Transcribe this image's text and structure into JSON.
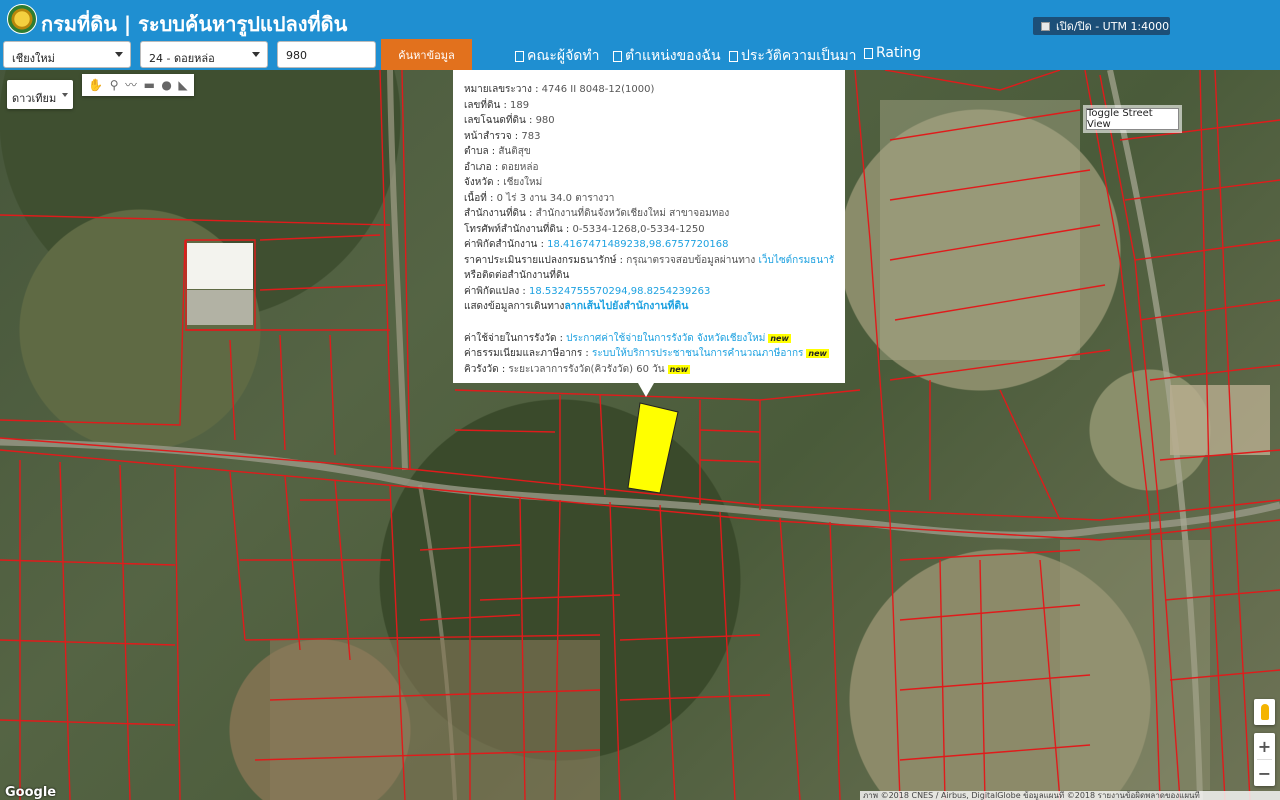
{
  "header": {
    "title": "กรมที่ดิน | ระบบค้นหารูปแปลงที่ดิน",
    "utm_toggle": "เปิด/ปิด - UTM 1:4000"
  },
  "search": {
    "province": "เชียงใหม่",
    "district": "24 - ดอยหล่อ",
    "parcel_number": "980",
    "button_label": "ค้นหาข้อมูล"
  },
  "nav": {
    "items": [
      {
        "label": "คณะผู้จัดทำ"
      },
      {
        "label": "ตำแหน่งของฉัน"
      },
      {
        "label": "ประวัติความเป็นมา"
      },
      {
        "label": "Rating"
      }
    ]
  },
  "map": {
    "type_selected": "ดาวเทียม",
    "streetview_label": "Toggle Street View",
    "google_logo": "Google",
    "attribution": "ภาพ ©2018 CNES / Airbus, DigitalGlobe  ข้อมูลแผนที่ ©2018  รายงานข้อผิดพลาดของแผนที่",
    "zoom_in": "+",
    "zoom_out": "−",
    "highlight_color": "#ffff00",
    "parcel_line_color": "#e01b1b"
  },
  "draw_tools": [
    {
      "icon": "hand-icon",
      "glyph": "✋"
    },
    {
      "icon": "marker-icon",
      "glyph": "⚲"
    },
    {
      "icon": "polyline-icon",
      "glyph": "〰"
    },
    {
      "icon": "rectangle-icon",
      "glyph": "▬"
    },
    {
      "icon": "circle-icon",
      "glyph": "●"
    },
    {
      "icon": "polygon-icon",
      "glyph": "◣"
    }
  ],
  "info": {
    "map_sheet_label": "หมายเลขระวาง",
    "map_sheet": "4746 II 8048-12(1000)",
    "land_no_label": "เลขที่ดิน",
    "land_no": "189",
    "deed_no_label": "เลขโฉนดที่ดิน",
    "deed_no": "980",
    "survey_page_label": "หน้าสำรวจ",
    "survey_page": "783",
    "subdistrict_label": "ตำบล",
    "subdistrict": "สันติสุข",
    "district_label": "อำเภอ",
    "district": "ดอยหล่อ",
    "province_label": "จังหวัด",
    "province": "เชียงใหม่",
    "area_label": "เนื้อที่",
    "area": "0 ไร่ 3 งาน 34.0 ตารางวา",
    "office_label": "สำนักงานที่ดิน",
    "office": "สำนักงานที่ดินจังหวัดเชียงใหม่ สาขาจอมทอง",
    "phone_label": "โทรศัพท์สำนักงานที่ดิน",
    "phone": "0-5334-1268,0-5334-1250",
    "office_coord_label": "ค่าพิกัดสำนักงาน",
    "office_coord": "18.4167471489238,98.6757720168",
    "price_label": "ราคาประเมินรายแปลงกรมธนารักษ์",
    "price_text": "กรุณาตรวจสอบข้อมูลผ่านทาง",
    "price_link": "เว็บไซต์กรมธนารักษ์",
    "price_line2": "หรือติดต่อสำนักงานที่ดิน",
    "parcel_coord_label": "ค่าพิกัดแปลง",
    "parcel_coord": "18.5324755570294,98.8254239263",
    "route_label": "แสดงข้อมูลการเดินทาง",
    "route_link": "ลากเส้นไปยังสำนักงานที่ดิน",
    "fee_label": "ค่าใช้จ่ายในการรังวัด",
    "fee_link": "ประกาศค่าใช้จ่ายในการรังวัด จังหวัดเชียงใหม่",
    "tax_label": "ค่าธรรมเนียมและภาษีอากร",
    "tax_link": "ระบบให้บริการประชาชนในการคำนวณภาษีอากร",
    "queue_label": "คิวรังวัด",
    "queue_text": "ระยะเวลาการรังวัด(คิวรังวัด) 60 วัน",
    "new_badge": "new"
  }
}
